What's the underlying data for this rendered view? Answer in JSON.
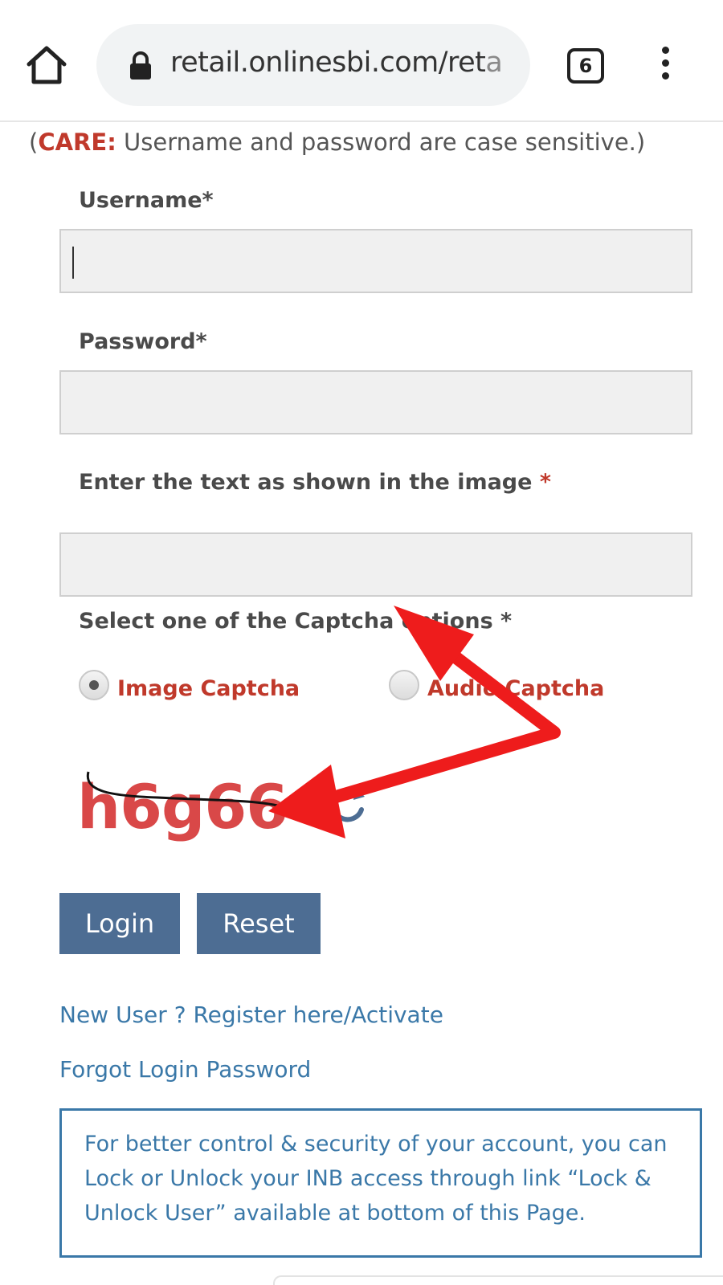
{
  "browser": {
    "url_main": "retail.onlinesbi.com/ret",
    "url_faded": "a",
    "tab_count": "6",
    "icons": [
      "home-icon",
      "lock-icon",
      "tabs-icon",
      "more-vert-icon"
    ]
  },
  "form": {
    "care_open": "(",
    "care_word": "CARE:",
    "care_text": " Username and password are case sensitive.)",
    "username_label": "Username*",
    "username_value": "",
    "password_label": "Password*",
    "password_value": "",
    "captcha_label": "Enter the text as shown in the image ",
    "captcha_required": "*",
    "captcha_value": "",
    "captcha_option_label": "Select one of the Captcha options *",
    "options": [
      {
        "label": "Image Captcha",
        "selected": true
      },
      {
        "label": "Audio Captcha",
        "selected": false
      }
    ],
    "captcha_image_text": "h6g66",
    "login_label": "Login",
    "reset_label": "Reset"
  },
  "links": {
    "register": "New User ? Register here/Activate",
    "forgot": "Forgot Login Password"
  },
  "info": {
    "text": "For better control & security of your account, you can Lock or Unlock your INB access through link “Lock & Unlock User” available at bottom of this Page."
  },
  "colors": {
    "accent_red": "#c0392b",
    "button_blue": "#4d6d93",
    "link_blue": "#3a78a8",
    "annotation_red": "#ee1c1c"
  }
}
